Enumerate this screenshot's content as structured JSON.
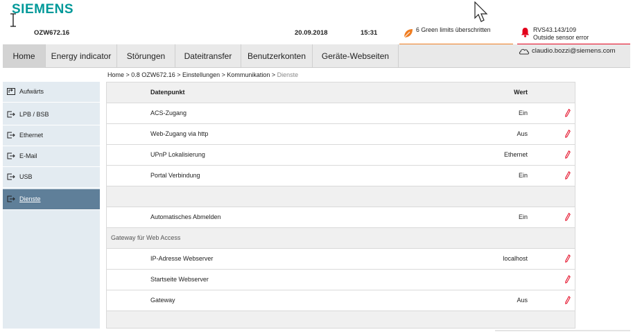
{
  "header": {
    "brand": "SIEMENS",
    "device": "OZW672.16",
    "date": "20.09.2018",
    "time": "15:31",
    "alert_green": "6 Green limits überschritten",
    "alert_red_line1": "RVS43.143/109",
    "alert_red_line2": "Outside sensor error",
    "user": "claudio.bozzi@siemens.com"
  },
  "nav": {
    "tabs": [
      {
        "label": "Home"
      },
      {
        "label": "Energy indicator"
      },
      {
        "label": "Störungen"
      },
      {
        "label": "Dateitransfer"
      },
      {
        "label": "Benutzerkonten"
      },
      {
        "label": "Geräte-Webseiten"
      }
    ]
  },
  "breadcrumb": {
    "path": "Home > 0.8 OZW672.16 > Einstellungen > Kommunikation > ",
    "current": "Dienste"
  },
  "sidebar": {
    "items": [
      {
        "label": "Aufwärts"
      },
      {
        "label": "LPB / BSB"
      },
      {
        "label": "Ethernet"
      },
      {
        "label": "E-Mail"
      },
      {
        "label": "USB"
      },
      {
        "label": "Dienste"
      }
    ]
  },
  "table": {
    "header_name": "Datenpunkt",
    "header_value": "Wert",
    "rows": [
      {
        "name": "ACS-Zugang",
        "value": "Ein"
      },
      {
        "name": "Web-Zugang via http",
        "value": "Aus"
      },
      {
        "name": "UPnP Lokalisierung",
        "value": "Ethernet"
      },
      {
        "name": "Portal Verbindung",
        "value": "Ein"
      },
      {
        "name": "Automatisches Abmelden",
        "value": "Ein"
      },
      {
        "name": "IP-Adresse Webserver",
        "value": "localhost"
      },
      {
        "name": "Startseite Webserver",
        "value": ""
      },
      {
        "name": "Gateway",
        "value": "Aus"
      }
    ],
    "group_label": "Gateway für Web Access"
  },
  "colors": {
    "brand": "#009999",
    "nav_bg": "#e9e9e9",
    "sidebar_bg": "#e3ebf1",
    "sidebar_active": "#5f7f99",
    "alert_orange": "#ef7d21",
    "alert_red": "#e3001b",
    "edit_icon": "#e3001b"
  },
  "icons": {
    "alert_green": "leaf-icon",
    "alert_red": "bell-icon",
    "user": "cloud-icon",
    "edit": "pencil-icon",
    "sidebar_up": "up-level-icon",
    "sidebar_nav": "arrow-box-icon"
  }
}
